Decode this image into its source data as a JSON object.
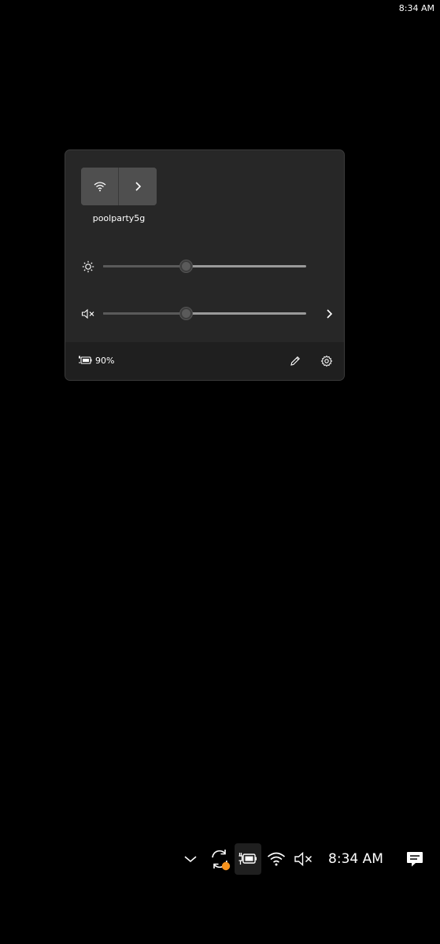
{
  "status_bar": {
    "time": "8:34 AM"
  },
  "quick_settings": {
    "wifi_tile": {
      "label": "poolparty5g"
    },
    "brightness": {
      "value": 0.41
    },
    "volume": {
      "value": 0.41,
      "muted": true
    },
    "battery": {
      "percent": "90%"
    }
  },
  "taskbar": {
    "time": "8:34 AM"
  },
  "colors": {
    "background": "#000000",
    "panel": "#272727",
    "footer": "#1f1f1f",
    "tile": "#4f4f4f",
    "update_badge": "#f7931e"
  }
}
